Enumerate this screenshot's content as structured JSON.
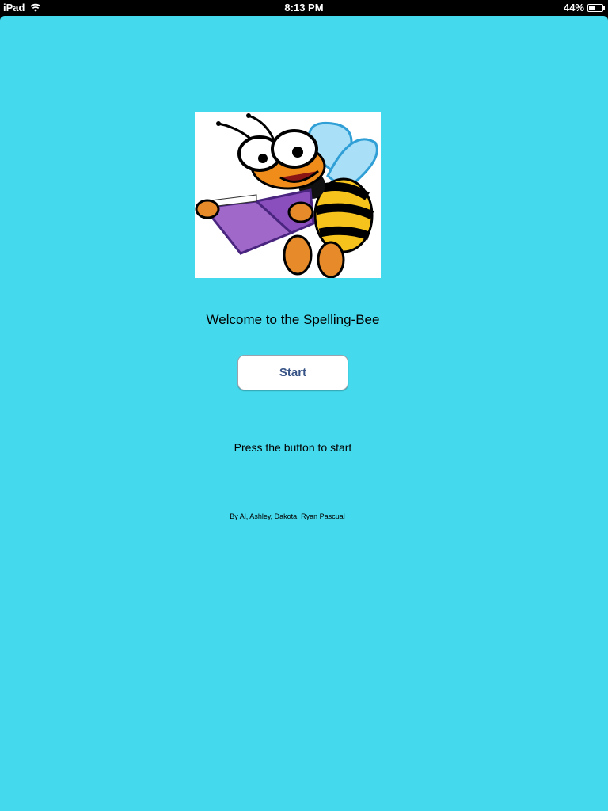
{
  "status_bar": {
    "device": "iPad",
    "time": "8:13 PM",
    "battery_percent": "44%",
    "battery_level": 0.44,
    "wifi_icon": "wifi-icon",
    "battery_icon": "battery-icon"
  },
  "main": {
    "background_color": "#44d9ec",
    "logo_icon": "bee-reading-book-icon",
    "welcome_text": "Welcome to the Spelling-Bee",
    "start_button_label": "Start",
    "instruction_text": "Press the button to start",
    "credits_text": "By Al, Ashley, Dakota, Ryan Pascual"
  }
}
